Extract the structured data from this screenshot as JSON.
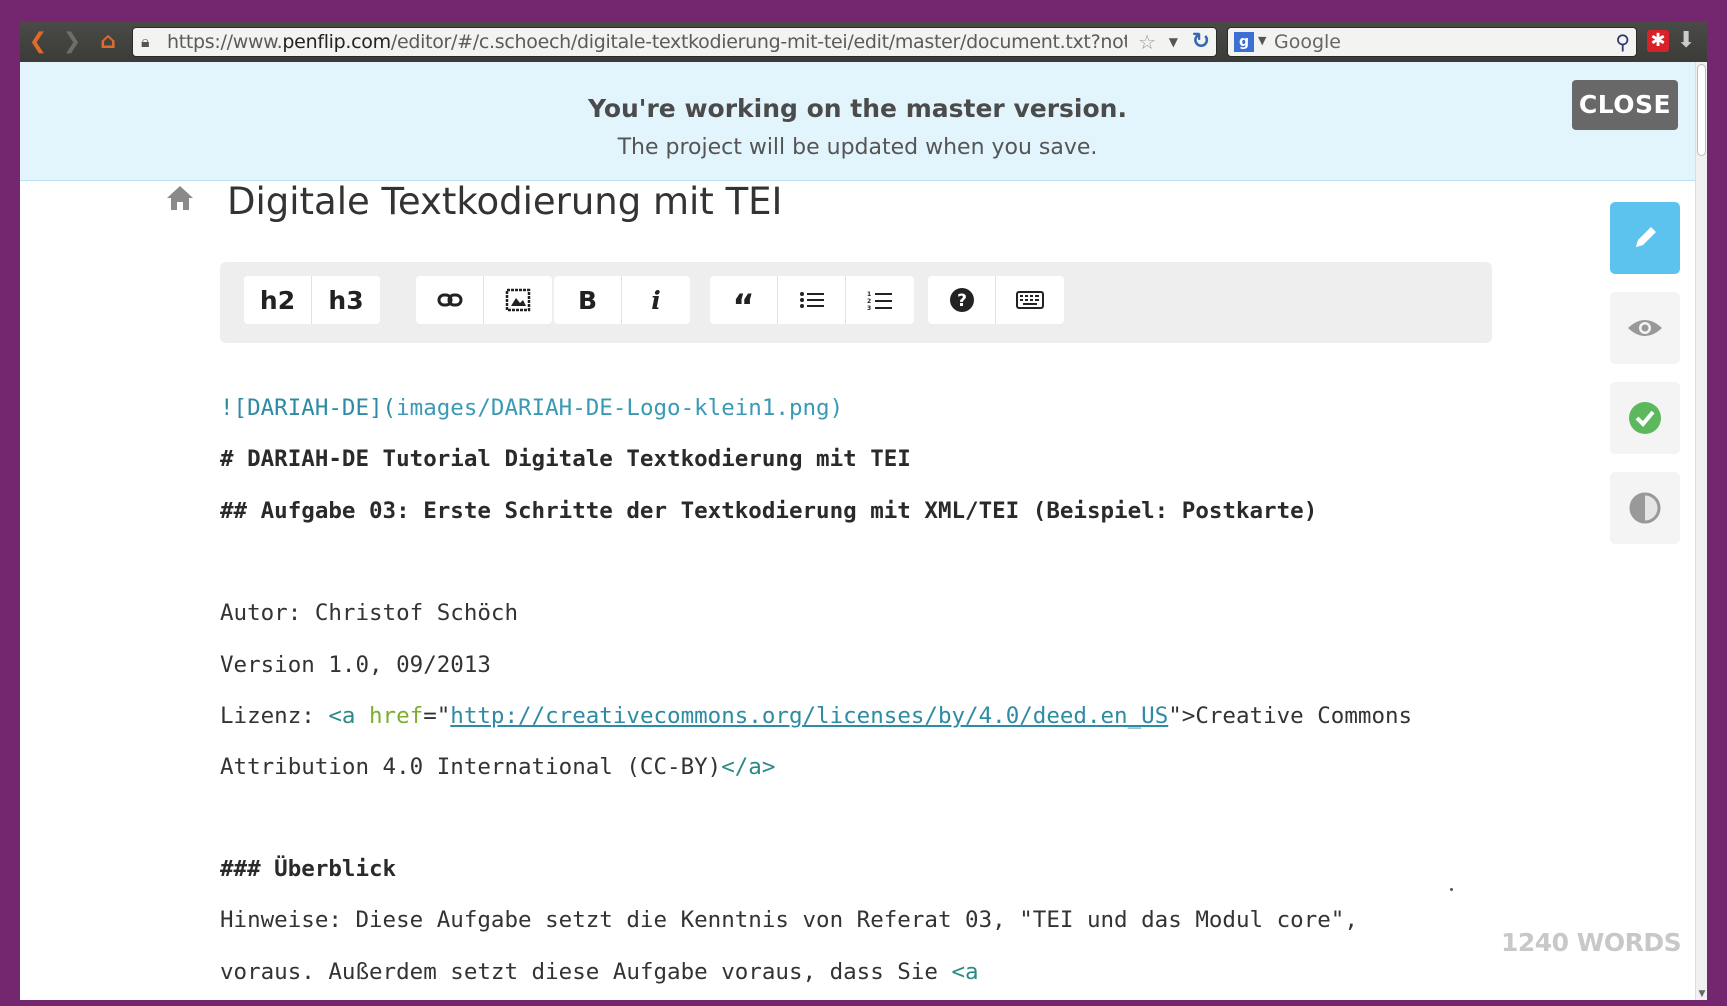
{
  "browser": {
    "url_prefix": "https://www.",
    "url_domain": "penflip.com",
    "url_path": "/editor/#/c.schoech/digitale-textkodierung-mit-tei/edit/master/document.txt?notify",
    "search_placeholder": "Google",
    "search_engine_icon": "google-icon"
  },
  "notice": {
    "title": "You're working on the master version.",
    "subtitle": "The project will be updated when you save.",
    "close_label": "CLOSE"
  },
  "document": {
    "title": "Digitale Textkodierung mit TEI",
    "word_count": "1240 WORDS"
  },
  "toolbar": {
    "h2": "h2",
    "h3": "h3",
    "bold": "B",
    "italic": "i",
    "quote": "“"
  },
  "editor": {
    "line1_prefix": "![",
    "line1_alt": "DARIAH-DE",
    "line1_mid": "](",
    "line1_url": "images/DARIAH-DE-Logo-klein1.png",
    "line1_end": ")",
    "line2": "# DARIAH-DE Tutorial Digitale Textkodierung mit TEI",
    "line3": "## Aufgabe 03: Erste Schritte der Textkodierung mit XML/TEI (Beispiel: Postkarte)",
    "line4": "Autor: Christof Schöch",
    "line5": "Version 1.0, 09/2013",
    "line6_label": "Lizenz: ",
    "line6_tag_open": "<a ",
    "line6_attr": "href",
    "line6_eq": "=\"",
    "line6_url": "http://creativecommons.org/licenses/by/4.0/deed.en_US",
    "line6_close_quote": "\"",
    "line6_gt": ">",
    "line6_text": "Creative Commons",
    "line7_text": "Attribution 4.0 International (CC-BY)",
    "line7_tag_close": "</a>",
    "line8": "### Überblick",
    "line9": "Hinweise: Diese Aufgabe setzt die Kenntnis von Referat 03, \"TEI und das Modul core\",",
    "line10_text": "voraus. Außerdem setzt diese Aufgabe voraus, dass Sie ",
    "line10_tag": "<a"
  },
  "colors": {
    "accent": "#5cc3ee",
    "frame": "#74266f",
    "notice_bg": "#e2f5fc",
    "check": "#5cb85c"
  }
}
